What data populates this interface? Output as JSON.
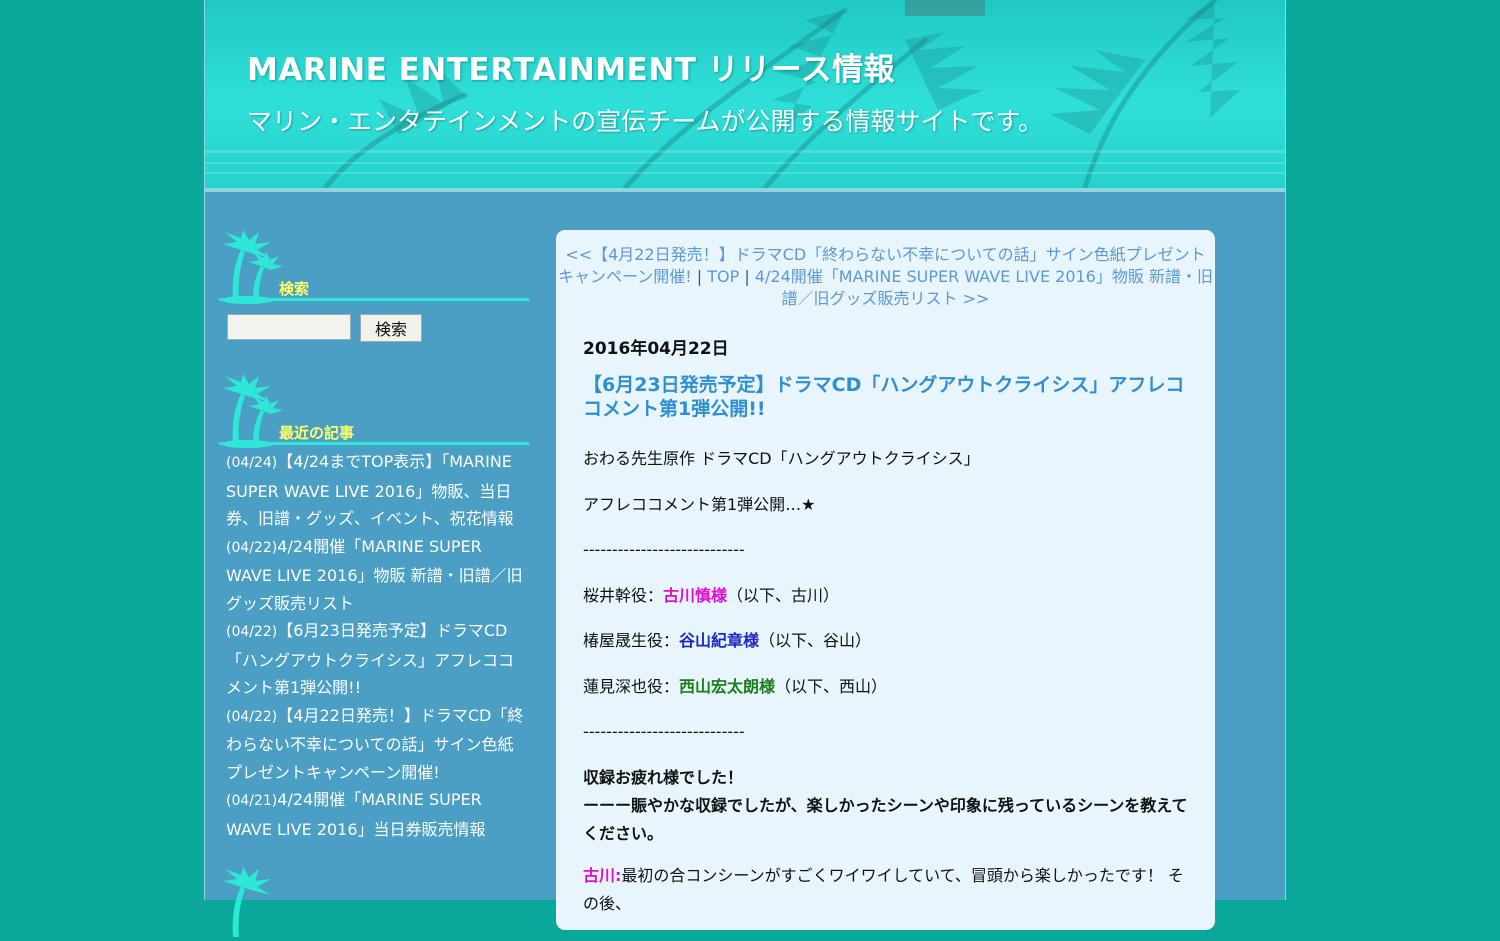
{
  "header": {
    "title": "MARINE ENTERTAINMENT リリース情報",
    "description": "マリン・エンタテインメントの宣伝チームが公開する情報サイトです。"
  },
  "sidebar": {
    "search": {
      "heading": "検索",
      "input_value": "",
      "button_label": "検索"
    },
    "recent": {
      "heading": "最近の記事",
      "items": [
        {
          "date": "(04/24)",
          "title": "【4/24までTOP表示】「MARINE SUPER WAVE LIVE 2016」物販、当日券、旧譜・グッズ、イベント、祝花情報"
        },
        {
          "date": "(04/22)",
          "title": "4/24開催「MARINE SUPER WAVE LIVE 2016」物販 新譜・旧譜／旧グッズ販売リスト"
        },
        {
          "date": "(04/22)",
          "title": "【6月23日発売予定】ドラマCD「ハングアウトクライシス」アフレココメント第1弾公開!!"
        },
        {
          "date": "(04/22)",
          "title": "【4月22日発売！】ドラマCD「終わらない不幸についての話」サイン色紙プレゼントキャンペーン開催!"
        },
        {
          "date": "(04/21)",
          "title": "4/24開催「MARINE SUPER WAVE LIVE 2016」当日券販売情報"
        }
      ]
    }
  },
  "main": {
    "nav": {
      "prev": "<<【4月22日発売！】ドラマCD「終わらない不幸についての話」サイン色紙プレゼントキャンペーン開催!",
      "sep1": "|",
      "top": "TOP",
      "sep2": "|",
      "next": "4/24開催「MARINE SUPER WAVE LIVE 2016」物販 新譜・旧譜／旧グッズ販売リスト >>"
    },
    "entry": {
      "date": "2016年04月22日",
      "title": "【6月23日発売予定】ドラマCD「ハングアウトクライシス」アフレココメント第1弾公開!!",
      "intro1": "おわる先生原作 ドラマCD「ハングアウトクライシス」",
      "intro2": "アフレココメント第1弾公開…★",
      "divider": "----------------------------",
      "cast": [
        {
          "role": "桜井幹役：",
          "name": "古川慎様",
          "abbr": "（以下、古川）"
        },
        {
          "role": "椿屋晟生役：",
          "name": "谷山紀章様",
          "abbr": "（以下、谷山）"
        },
        {
          "role": "蓮見深也役：",
          "name": "西山宏太朗様",
          "abbr": "（以下、西山）"
        }
      ],
      "greeting": "収録お疲れ様でした！",
      "question": "ーーー賑やかな収録でしたが、楽しかったシーンや印象に残っているシーンを教えてください。",
      "answer_speaker": "古川:",
      "answer_text": "最初の合コンシーンがすごくワイワイしていて、冒頭から楽しかったです！ その後、"
    }
  },
  "colors": {
    "background": "#0aa89a",
    "page": "#4b9fc4",
    "header": "#2fe0d8",
    "main_panel": "#e8f5fc",
    "link": "#5b9ad6",
    "entry_title": "#2f8fd3",
    "widget_heading": "#ffff66",
    "actor_furukawa": "#e00fcf",
    "actor_taniyama": "#1a27c9",
    "actor_nishiyama": "#1c7d1c"
  }
}
